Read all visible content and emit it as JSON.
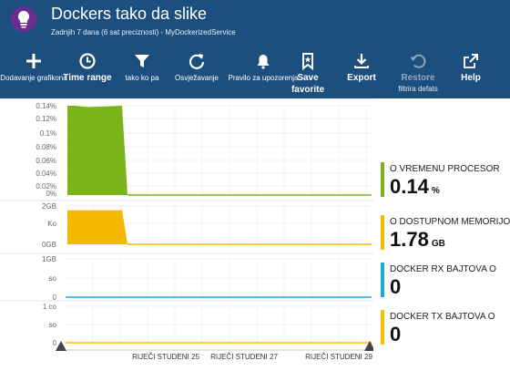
{
  "header": {
    "title": "Dockers tako da slike",
    "subtitle": "Zadnjih  7  dana  (6  sat  preciznosti) - MyDockerizedService",
    "bg_color": "#1d4f7e"
  },
  "toolbar": [
    {
      "icon": "plus-icon",
      "label": "Dodavanje grafikona",
      "size": "small",
      "disabled": false
    },
    {
      "icon": "clock-icon",
      "label": "Time range",
      "size": "big",
      "disabled": false
    },
    {
      "icon": "filter-icon",
      "label": "tako ko pa",
      "size": "small",
      "disabled": false
    },
    {
      "icon": "refresh-icon",
      "label": "Osvježavanje",
      "size": "small",
      "disabled": false
    },
    {
      "icon": "bell-icon",
      "label": "Pravilo za upozorenja",
      "size": "small",
      "disabled": false
    },
    {
      "icon": "bookmark-icon",
      "label": "Save",
      "sub": "favorite",
      "size": "big",
      "disabled": false
    },
    {
      "icon": "download-icon",
      "label": "Export",
      "size": "big",
      "disabled": false
    },
    {
      "icon": "restore-icon",
      "label": "Restore",
      "sub": "filtrira defats",
      "size": "big",
      "disabled": true
    },
    {
      "icon": "external-link-icon",
      "label": "Help",
      "size": "big",
      "disabled": false
    }
  ],
  "chart_data": [
    {
      "type": "area",
      "name": "O VREMENU PROCESOR",
      "y_ticks": [
        "0.14%",
        "0.12%",
        "0.1%",
        "0.08%",
        "0.06%",
        "0.04%",
        "0.02%",
        "0%"
      ],
      "ylim": [
        0,
        0.14
      ],
      "x": [
        "start",
        "1",
        "2",
        "3",
        "4",
        "5"
      ],
      "values": [
        0.14,
        0.14,
        0.138,
        0.139,
        0.14,
        0
      ],
      "color": "#7bb31a"
    },
    {
      "type": "area",
      "name": "O DOSTUPNOM MEMORIJOM",
      "y_ticks": [
        "2GB",
        "Ko",
        "0GB"
      ],
      "ylim": [
        0,
        2
      ],
      "x": [
        "start",
        "1",
        "2",
        "3",
        "4"
      ],
      "values": [
        1.78,
        1.78,
        1.78,
        1.78,
        0
      ],
      "color": "#f5b800"
    },
    {
      "type": "line",
      "name": "DOCKER RX BAJTOVA O",
      "y_ticks": [
        "1GB",
        "so",
        "0"
      ],
      "ylim": [
        0,
        1
      ],
      "values": [
        0,
        0
      ],
      "color": "#1ca7dd"
    },
    {
      "type": "line",
      "name": "DOCKER TX BAJTOVA O",
      "y_ticks": [
        "1 co",
        "so",
        "0"
      ],
      "ylim": [
        0,
        1
      ],
      "values": [
        0,
        0
      ],
      "color": "#f5c400"
    }
  ],
  "x_axis": {
    "labels": [
      "RIJEČI STUDENI 25",
      "RIJEČI STUDENI 27",
      "RIJEČI STUDENI 29"
    ]
  },
  "legend": [
    {
      "name": "O VREMENU PROCESOR",
      "value": "0.14",
      "unit": "%",
      "color": "#7bb31a"
    },
    {
      "name": "O DOSTUPNOM MEMORIJOM",
      "value": "1.78",
      "unit": "GB",
      "color": "#f5b800"
    },
    {
      "name": "DOCKER RX BAJTOVA O",
      "value": "0",
      "unit": "",
      "color": "#1ca7dd"
    },
    {
      "name": "DOCKER TX BAJTOVA O",
      "value": "0",
      "unit": "",
      "color": "#f5c400"
    }
  ]
}
